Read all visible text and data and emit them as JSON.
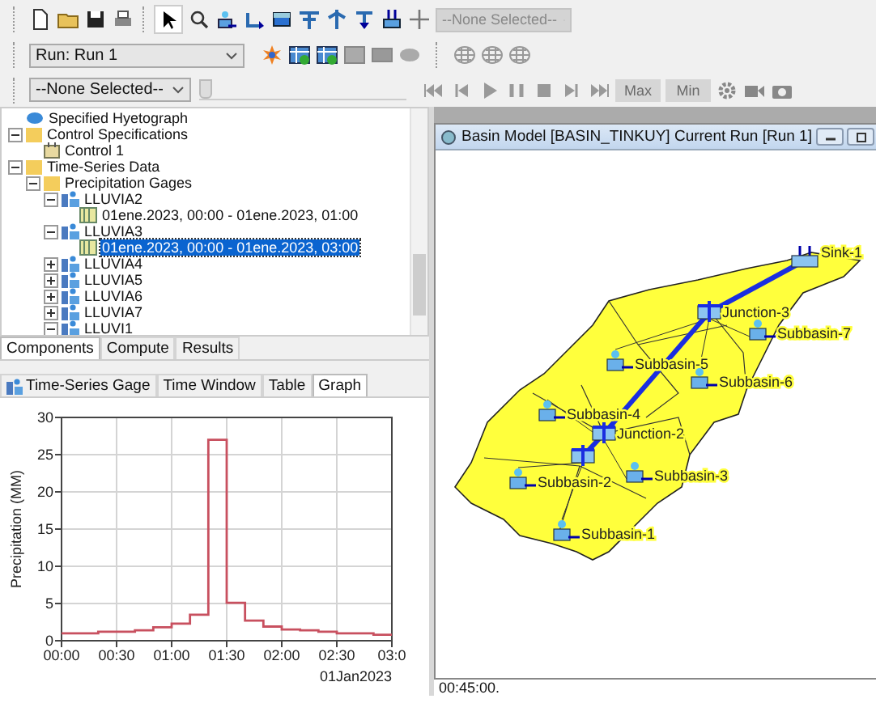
{
  "toolbar": {
    "element_dropdown": {
      "value": "--None Selected--",
      "disabled": true
    },
    "run_dropdown": {
      "value": "Run: Run 1",
      "disabled": false
    },
    "time_dropdown": {
      "value": "--None Selected--",
      "disabled": false
    },
    "time_slider": {
      "level": 0,
      "disabled": true
    },
    "extreme_buttons": [
      {
        "label": "Max",
        "disabled": true
      },
      {
        "label": "Min",
        "disabled": true
      }
    ]
  },
  "tree": {
    "items": [
      {
        "label": "Specified Hyetograph",
        "kind": "method",
        "selected": false
      },
      {
        "label": "Control Specifications",
        "kind": "folder",
        "expanded": true,
        "selected": false,
        "children": [
          {
            "label": "Control 1",
            "kind": "control",
            "selected": false
          }
        ]
      },
      {
        "label": "Time-Series Data",
        "kind": "folder",
        "expanded": true,
        "selected": false,
        "children": [
          {
            "label": "Precipitation Gages",
            "kind": "folder",
            "expanded": true,
            "selected": false,
            "children": [
              {
                "label": "LLUVIA2",
                "kind": "gage",
                "expanded": true,
                "selected": false,
                "children": [
                  {
                    "label": "01ene.2023, 00:00 - 01ene.2023, 01:00",
                    "kind": "data",
                    "selected": false
                  }
                ]
              },
              {
                "label": "LLUVIA3",
                "kind": "gage",
                "expanded": true,
                "selected": false,
                "children": [
                  {
                    "label": "01ene.2023, 00:00 - 01ene.2023, 03:00",
                    "kind": "data",
                    "selected": true
                  }
                ]
              },
              {
                "label": "LLUVIA4",
                "kind": "gage",
                "expanded": false,
                "selected": false
              },
              {
                "label": "LLUVIA5",
                "kind": "gage",
                "expanded": false,
                "selected": false
              },
              {
                "label": "LLUVIA6",
                "kind": "gage",
                "expanded": false,
                "selected": false
              },
              {
                "label": "LLUVIA7",
                "kind": "gage",
                "expanded": false,
                "selected": false
              },
              {
                "label": "LLUVI1",
                "kind": "gage",
                "expanded": true,
                "selected": false
              }
            ]
          }
        ]
      }
    ]
  },
  "explorer_tabs": [
    {
      "label": "Components",
      "selected": true
    },
    {
      "label": "Compute",
      "selected": false
    },
    {
      "label": "Results",
      "selected": false
    }
  ],
  "editor": {
    "tabs": [
      {
        "label": "Time-Series Gage",
        "selected": false
      },
      {
        "label": "Time Window",
        "selected": false
      },
      {
        "label": "Table",
        "selected": false
      },
      {
        "label": "Graph",
        "selected": true
      }
    ],
    "chart_data": {
      "type": "line",
      "xlabel": "01Jan2023",
      "ylabel": "Precipitation (MM)",
      "grid": true,
      "x": [
        0,
        10,
        10,
        20,
        20,
        30,
        30,
        40,
        40,
        50,
        50,
        60,
        60,
        70,
        70,
        80,
        80,
        90,
        90,
        100,
        100,
        110,
        110,
        120,
        120,
        130,
        130,
        140,
        140,
        150,
        150,
        160,
        160,
        170,
        170,
        180
      ],
      "series": [
        {
          "color": "#c8505f",
          "values": [
            1.0,
            1.0,
            1.0,
            1.0,
            1.2,
            1.2,
            1.2,
            1.2,
            1.4,
            1.4,
            1.8,
            1.8,
            2.3,
            2.3,
            3.5,
            3.5,
            27.0,
            27.0,
            5.1,
            5.1,
            2.7,
            2.7,
            1.9,
            1.9,
            1.5,
            1.5,
            1.4,
            1.4,
            1.2,
            1.2,
            1.0,
            1.0,
            1.0,
            1.0,
            0.8,
            0.8
          ]
        }
      ],
      "xlim": [
        0,
        180
      ],
      "ylim": [
        0,
        30
      ],
      "xticks": [
        {
          "value": 0,
          "label": "00:00"
        },
        {
          "value": 30,
          "label": "00:30"
        },
        {
          "value": 60,
          "label": "01:00"
        },
        {
          "value": 90,
          "label": "01:30"
        },
        {
          "value": 120,
          "label": "02:00"
        },
        {
          "value": 150,
          "label": "02:30"
        },
        {
          "value": 180,
          "label": "03:0"
        }
      ],
      "yticks": [
        0,
        5,
        10,
        15,
        20,
        25,
        30
      ]
    }
  },
  "basin_window": {
    "title": "Basin Model [BASIN_TINKUY] Current Run [Run 1]",
    "nodes": [
      {
        "kind": "sink",
        "name": "Sink-1"
      },
      {
        "kind": "junction",
        "name": "Junction-3"
      },
      {
        "kind": "subbasin",
        "name": "Subbasin-7"
      },
      {
        "kind": "subbasin",
        "name": "Subbasin-5"
      },
      {
        "kind": "subbasin",
        "name": "Subbasin-6"
      },
      {
        "kind": "subbasin",
        "name": "Subbasin-4"
      },
      {
        "kind": "junction",
        "name": "Junction-2"
      },
      {
        "kind": "junction"
      },
      {
        "kind": "subbasin",
        "name": "Subbasin-2"
      },
      {
        "kind": "subbasin",
        "name": "Subbasin-3"
      },
      {
        "kind": "subbasin",
        "name": "Subbasin-1"
      }
    ]
  },
  "status_bar": {
    "time": "00:45:00."
  }
}
